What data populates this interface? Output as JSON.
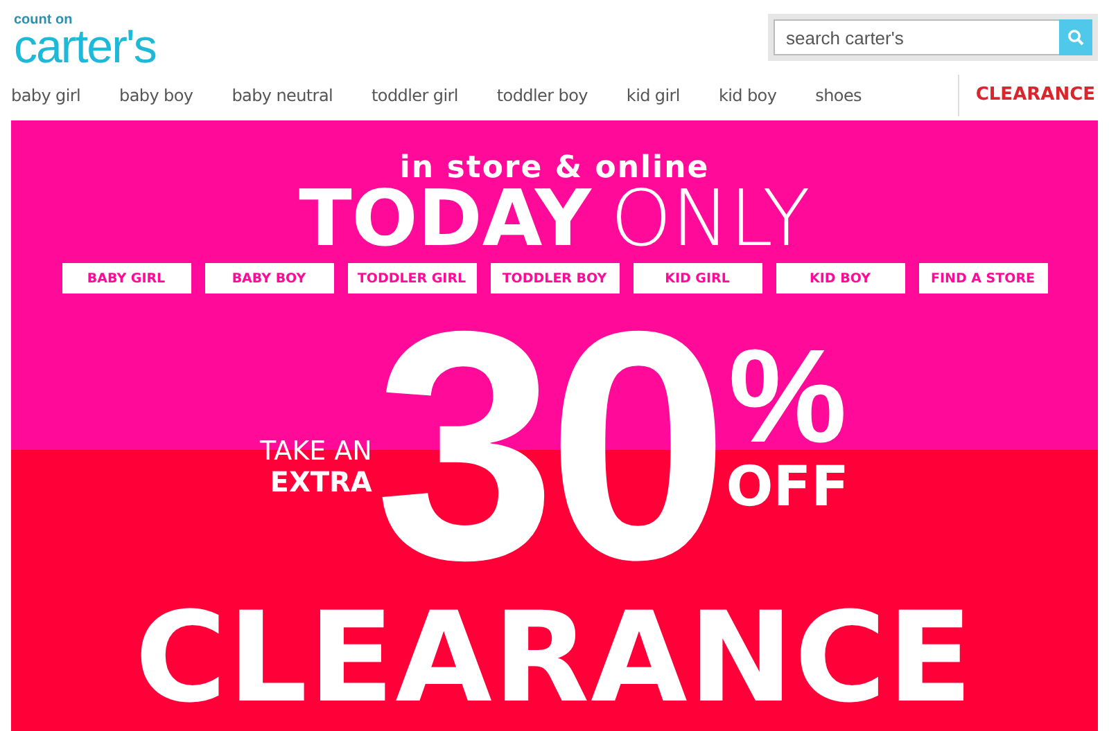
{
  "logo": {
    "tagline": "count on",
    "name": "carter's"
  },
  "search": {
    "placeholder": "search carter's"
  },
  "nav": {
    "items": [
      "baby girl",
      "baby boy",
      "baby neutral",
      "toddler girl",
      "toddler boy",
      "kid girl",
      "kid boy",
      "shoes"
    ],
    "clearance": "CLEARANCE"
  },
  "banner": {
    "subtitle": "in store & online",
    "headline_bold": "TODAY",
    "headline_light": "ONLY",
    "buttons": [
      "BABY GIRL",
      "BABY BOY",
      "TODDLER GIRL",
      "TODDLER BOY",
      "KID GIRL",
      "KID BOY",
      "FIND A STORE"
    ],
    "take_an": "TAKE AN",
    "extra": "EXTRA",
    "amount": "30",
    "percent": "%",
    "off": "OFF",
    "clearance": "CLEARANCE"
  }
}
